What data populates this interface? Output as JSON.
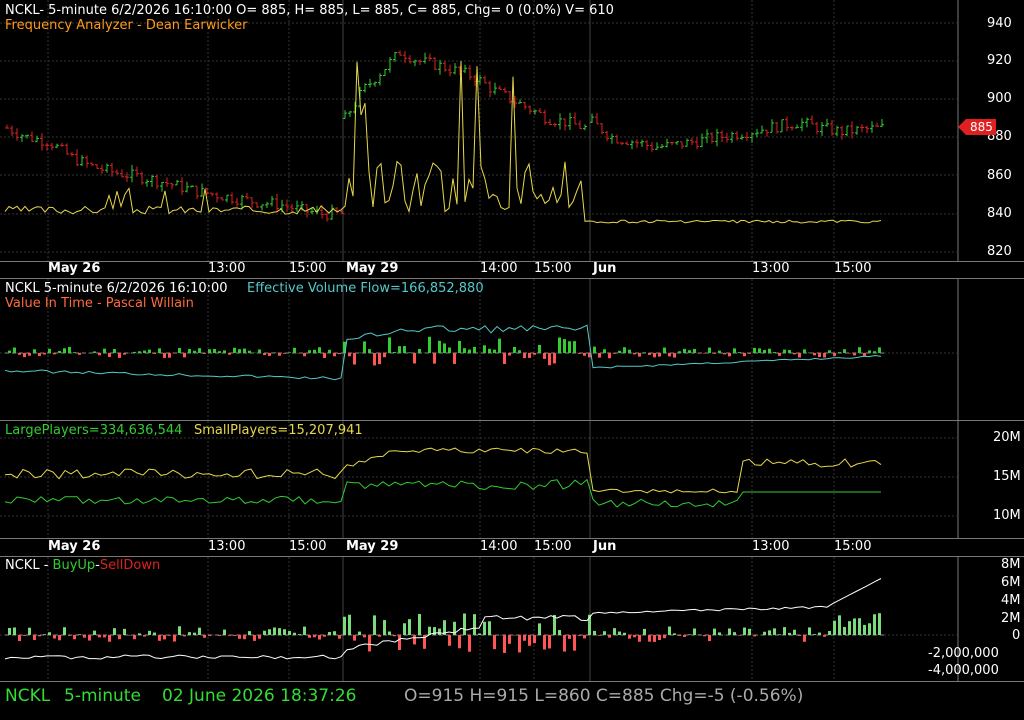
{
  "colors": {
    "up": "#33cc33",
    "down": "#dd2222",
    "yellow": "#e6d84a",
    "cyan": "#55c8c8",
    "white": "#ffffff",
    "orange": "#ff8c1a",
    "grid": "#333333"
  },
  "panel1": {
    "header": "NCKL- 5-minute 6/2/2026 16:10:00 O= 885, H= 885, L= 885, C= 885, Chg= 0 (0.0%) V= 610",
    "indicator": "Frequency Analyzer - Dean Earwicker",
    "price_ticks": [
      "940",
      "920",
      "900",
      "880",
      "860",
      "840",
      "820"
    ],
    "last_price": "885"
  },
  "xaxis": {
    "labels": [
      {
        "text": "May 26",
        "bold": true
      },
      {
        "text": "13:00",
        "bold": false
      },
      {
        "text": "15:00",
        "bold": false
      },
      {
        "text": "May 29",
        "bold": true
      },
      {
        "text": "14:00",
        "bold": false
      },
      {
        "text": "15:00",
        "bold": false
      },
      {
        "text": "Jun",
        "bold": true
      },
      {
        "text": "13:00",
        "bold": false
      },
      {
        "text": "15:00",
        "bold": false
      }
    ]
  },
  "panel2": {
    "title": "NCKL 5-minute  6/2/2026 16:10:00",
    "flow_label": "Effective Volume Flow=166,852,880",
    "indicator": "Value In Time - Pascal Willain"
  },
  "panel3": {
    "large_label": "LargePlayers=334,636,544",
    "small_label": "SmallPlayers=15,207,941",
    "ticks": [
      "20M",
      "15M",
      "10M"
    ]
  },
  "panel4": {
    "symbol": "NCKL -",
    "buy": "BuyUp",
    "dash": "-",
    "sell": "SellDown",
    "ticks": [
      "8M",
      "6M",
      "4M",
      "2M",
      "0",
      "-2,000,000",
      "-4,000,000"
    ]
  },
  "status": {
    "symbol": "NCKL",
    "interval": "5-minute",
    "datetime": "02 June 2026 18:37:26",
    "ohlc": "O=915  H=915  L=860  C=885  Chg=-5 (-0.56%)"
  },
  "chart_data": [
    {
      "type": "bar",
      "title": "NCKL- 5-minute",
      "ylim": [
        810,
        950
      ],
      "close_segments": [
        {
          "from": "May 26",
          "values": [
            885,
            880,
            878,
            870,
            865,
            862,
            860,
            858,
            855,
            852,
            850,
            848,
            846,
            845,
            842,
            840,
            840
          ]
        },
        {
          "from": "May 29",
          "values": [
            890,
            905,
            915,
            925,
            920,
            918,
            915,
            912,
            905,
            900,
            895,
            890,
            888,
            885
          ]
        },
        {
          "from": "Jun",
          "values": [
            888,
            880,
            878,
            875,
            876,
            878,
            880,
            882,
            884,
            886,
            888,
            885,
            883,
            884,
            885
          ]
        }
      ],
      "last": 885
    },
    {
      "type": "line",
      "title": "Value In Time",
      "series": [
        {
          "name": "Effective Volume Flow",
          "last": 166852880
        }
      ]
    },
    {
      "type": "line",
      "series": [
        {
          "name": "LargePlayers",
          "last": 334636544
        },
        {
          "name": "SmallPlayers",
          "last": 15207941
        }
      ],
      "ylim": [
        7000000,
        22000000
      ]
    },
    {
      "type": "bar",
      "series": [
        {
          "name": "BuyUp"
        },
        {
          "name": "SellDown"
        }
      ],
      "ylim": [
        -4500000,
        8500000
      ]
    }
  ]
}
